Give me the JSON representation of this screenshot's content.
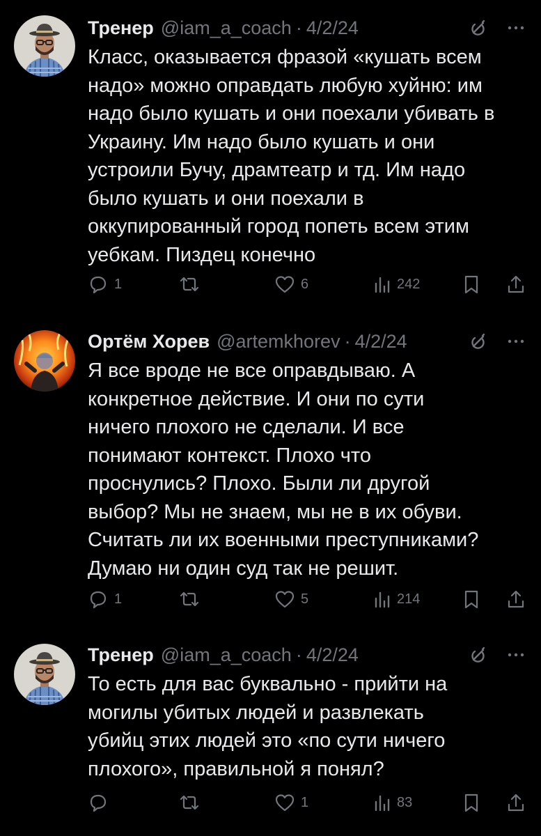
{
  "tweets": [
    {
      "name": "Тренер",
      "handle": "@iam_a_coach",
      "date": "4/2/24",
      "lines": [
        "Класс, оказывается фразой «кушать всем",
        "надо» можно оправдать любую хуйню: им",
        "надо было кушать и они поехали убивать в",
        "Украину. Им надо было кушать и они",
        "устроили Бучу, драмтеатр и тд. Им надо",
        "было кушать и они поехали в",
        "оккупированный город попеть всем этим",
        "уебкам. Пиздец конечно"
      ],
      "replies": "1",
      "retweets": "",
      "likes": "6",
      "views": "242"
    },
    {
      "name": "Ортём Хорев",
      "handle": "@artemkhorev",
      "date": "4/2/24",
      "lines": [
        "Я все вроде не все оправдываю. А",
        "конкретное действие. И они по сути",
        "ничего плохого не сделали. И все",
        "понимают контекст. Плохо что",
        "проснулись? Плохо. Были ли другой",
        "выбор? Мы не знаем, мы не в их обуви.",
        "Считать ли их военными преступниками?",
        "Думаю ни один суд так не решит."
      ],
      "replies": "1",
      "retweets": "",
      "likes": "5",
      "views": "214"
    },
    {
      "name": "Тренер",
      "handle": "@iam_a_coach",
      "date": "4/2/24",
      "lines": [
        "То есть для вас буквально - прийти на",
        "могилы убитых людей и развлекать",
        "убийц этих людей это «по сути ничего",
        "плохого», правильной я понял?"
      ],
      "replies": "",
      "retweets": "",
      "likes": "1",
      "views": "83"
    }
  ],
  "icons": {
    "reply": "reply-icon",
    "retweet": "retweet-icon",
    "like": "heart-icon",
    "views": "views-icon",
    "bookmark": "bookmark-icon",
    "share": "share-icon",
    "grok": "grok-icon",
    "more": "more-icon"
  },
  "colors": {
    "background": "#000000",
    "text": "#e7e9ea",
    "muted": "#71767b"
  }
}
